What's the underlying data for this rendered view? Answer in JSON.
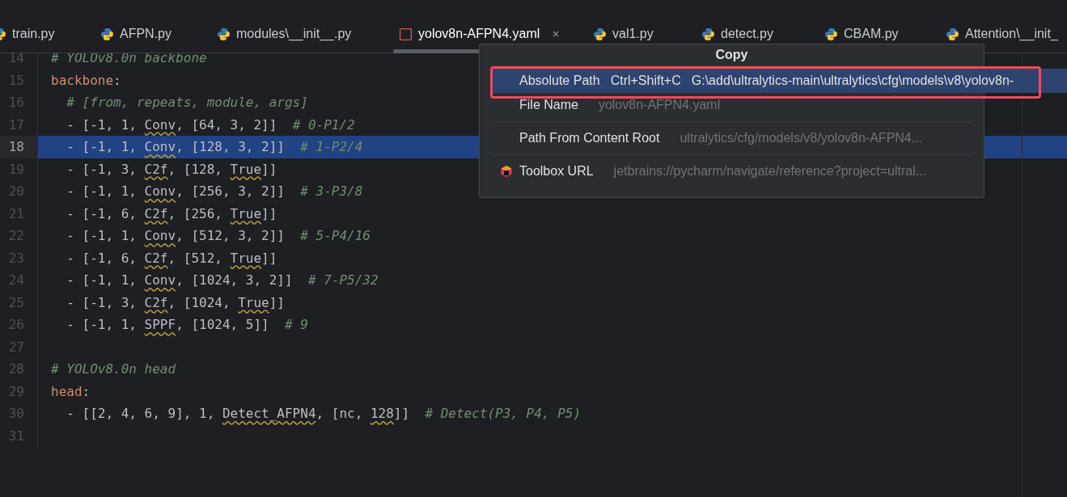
{
  "tabs": [
    {
      "label": "train.py",
      "kind": "python",
      "selected": false
    },
    {
      "label": "AFPN.py",
      "kind": "python",
      "selected": false
    },
    {
      "label": "modules\\__init__.py",
      "kind": "python",
      "selected": false
    },
    {
      "label": "yolov8n-AFPN4.yaml",
      "kind": "yaml",
      "selected": true
    },
    {
      "label": "val1.py",
      "kind": "python",
      "selected": false
    },
    {
      "label": "detect.py",
      "kind": "python",
      "selected": false
    },
    {
      "label": "CBAM.py",
      "kind": "python",
      "selected": false
    },
    {
      "label": "Attention\\__init_",
      "kind": "python",
      "selected": false
    }
  ],
  "editor": {
    "lines": [
      {
        "number": "14",
        "selected": false,
        "tokens": [
          {
            "text": "# YOLOv8.0n backbone",
            "kind": "comment"
          }
        ]
      },
      {
        "number": "15",
        "selected": false,
        "tokens": [
          {
            "text": "backbone",
            "kind": "key"
          },
          {
            "text": ":",
            "kind": "plain"
          }
        ]
      },
      {
        "number": "16",
        "selected": false,
        "tokens": [
          {
            "text": "  # [from, repeats, module, args]",
            "kind": "comment"
          }
        ]
      },
      {
        "number": "17",
        "selected": false,
        "tokens": [
          {
            "text": "  - [-1, 1, ",
            "kind": "plain"
          },
          {
            "text": "Conv",
            "kind": "warn"
          },
          {
            "text": ", [64, 3, 2]]  ",
            "kind": "plain"
          },
          {
            "text": "# 0-P1/2",
            "kind": "comment"
          }
        ]
      },
      {
        "number": "18",
        "selected": true,
        "tokens": [
          {
            "text": "  - [-1, 1, ",
            "kind": "plain"
          },
          {
            "text": "Conv",
            "kind": "warn"
          },
          {
            "text": ", [128, 3, 2]]  ",
            "kind": "plain"
          },
          {
            "text": "# 1-P2/4",
            "kind": "comment"
          }
        ]
      },
      {
        "number": "19",
        "selected": false,
        "tokens": [
          {
            "text": "  - [-1, 3, ",
            "kind": "plain"
          },
          {
            "text": "C2f",
            "kind": "warn"
          },
          {
            "text": ", [128, ",
            "kind": "plain"
          },
          {
            "text": "True",
            "kind": "warn"
          },
          {
            "text": "]]",
            "kind": "plain"
          }
        ]
      },
      {
        "number": "20",
        "selected": false,
        "tokens": [
          {
            "text": "  - [-1, 1, ",
            "kind": "plain"
          },
          {
            "text": "Conv",
            "kind": "warn"
          },
          {
            "text": ", [256, 3, 2]]  ",
            "kind": "plain"
          },
          {
            "text": "# 3-P3/8",
            "kind": "comment"
          }
        ]
      },
      {
        "number": "21",
        "selected": false,
        "tokens": [
          {
            "text": "  - [-1, 6, ",
            "kind": "plain"
          },
          {
            "text": "C2f",
            "kind": "warn"
          },
          {
            "text": ", [256, ",
            "kind": "plain"
          },
          {
            "text": "True",
            "kind": "warn"
          },
          {
            "text": "]]",
            "kind": "plain"
          }
        ]
      },
      {
        "number": "22",
        "selected": false,
        "tokens": [
          {
            "text": "  - [-1, 1, ",
            "kind": "plain"
          },
          {
            "text": "Conv",
            "kind": "warn"
          },
          {
            "text": ", [512, 3, 2]]  ",
            "kind": "plain"
          },
          {
            "text": "# 5-P4/16",
            "kind": "comment"
          }
        ]
      },
      {
        "number": "23",
        "selected": false,
        "tokens": [
          {
            "text": "  - [-1, 6, ",
            "kind": "plain"
          },
          {
            "text": "C2f",
            "kind": "warn"
          },
          {
            "text": ", [512, ",
            "kind": "plain"
          },
          {
            "text": "True",
            "kind": "warn"
          },
          {
            "text": "]]",
            "kind": "plain"
          }
        ]
      },
      {
        "number": "24",
        "selected": false,
        "tokens": [
          {
            "text": "  - [-1, 1, ",
            "kind": "plain"
          },
          {
            "text": "Conv",
            "kind": "warn"
          },
          {
            "text": ", [1024, 3, 2]]  ",
            "kind": "plain"
          },
          {
            "text": "# 7-P5/32",
            "kind": "comment"
          }
        ]
      },
      {
        "number": "25",
        "selected": false,
        "tokens": [
          {
            "text": "  - [-1, 3, ",
            "kind": "plain"
          },
          {
            "text": "C2f",
            "kind": "warn"
          },
          {
            "text": ", [1024, ",
            "kind": "plain"
          },
          {
            "text": "True",
            "kind": "warn"
          },
          {
            "text": "]]",
            "kind": "plain"
          }
        ]
      },
      {
        "number": "26",
        "selected": false,
        "tokens": [
          {
            "text": "  - [-1, 1, ",
            "kind": "plain"
          },
          {
            "text": "SPPF",
            "kind": "warn"
          },
          {
            "text": ", [1024, 5]]  ",
            "kind": "plain"
          },
          {
            "text": "# 9",
            "kind": "comment"
          }
        ]
      },
      {
        "number": "27",
        "selected": false
      },
      {
        "number": "28",
        "selected": false,
        "tokens": [
          {
            "text": "# YOLOv8.0n head",
            "kind": "comment"
          }
        ]
      },
      {
        "number": "29",
        "selected": false,
        "tokens": [
          {
            "text": "head",
            "kind": "key"
          },
          {
            "text": ":",
            "kind": "plain"
          }
        ]
      },
      {
        "number": "30",
        "selected": false,
        "tokens": [
          {
            "text": "  - [[2, 4, 6, 9], 1, ",
            "kind": "plain"
          },
          {
            "text": "Detect_AFPN4",
            "kind": "warn"
          },
          {
            "text": ", [nc, ",
            "kind": "plain"
          },
          {
            "text": "128",
            "kind": "warn"
          },
          {
            "text": "]]  ",
            "kind": "plain"
          },
          {
            "text": "# Detect(P3, P4, P5)",
            "kind": "comment"
          }
        ]
      },
      {
        "number": "31",
        "selected": false
      }
    ]
  },
  "popup": {
    "title": "Copy",
    "items": [
      {
        "label": "Absolute Path",
        "shortcut": "Ctrl+Shift+C",
        "value": "G:\\add\\ultralytics-main\\ultralytics\\cfg\\models\\v8\\yolov8n-",
        "selected": true,
        "kind": "plain"
      },
      {
        "label": "File Name",
        "value": "yolov8n-AFPN4.yaml",
        "selected": false,
        "kind": "plain"
      },
      {
        "label": "Path From Content Root",
        "value": "ultralytics/cfg/models/v8/yolov8n-AFPN4...",
        "selected": false,
        "kind": "plain"
      },
      {
        "label": "Toolbox URL",
        "value": "jetbrains://pycharm/navigate/reference?project=ultral...",
        "selected": false,
        "kind": "app"
      }
    ]
  }
}
